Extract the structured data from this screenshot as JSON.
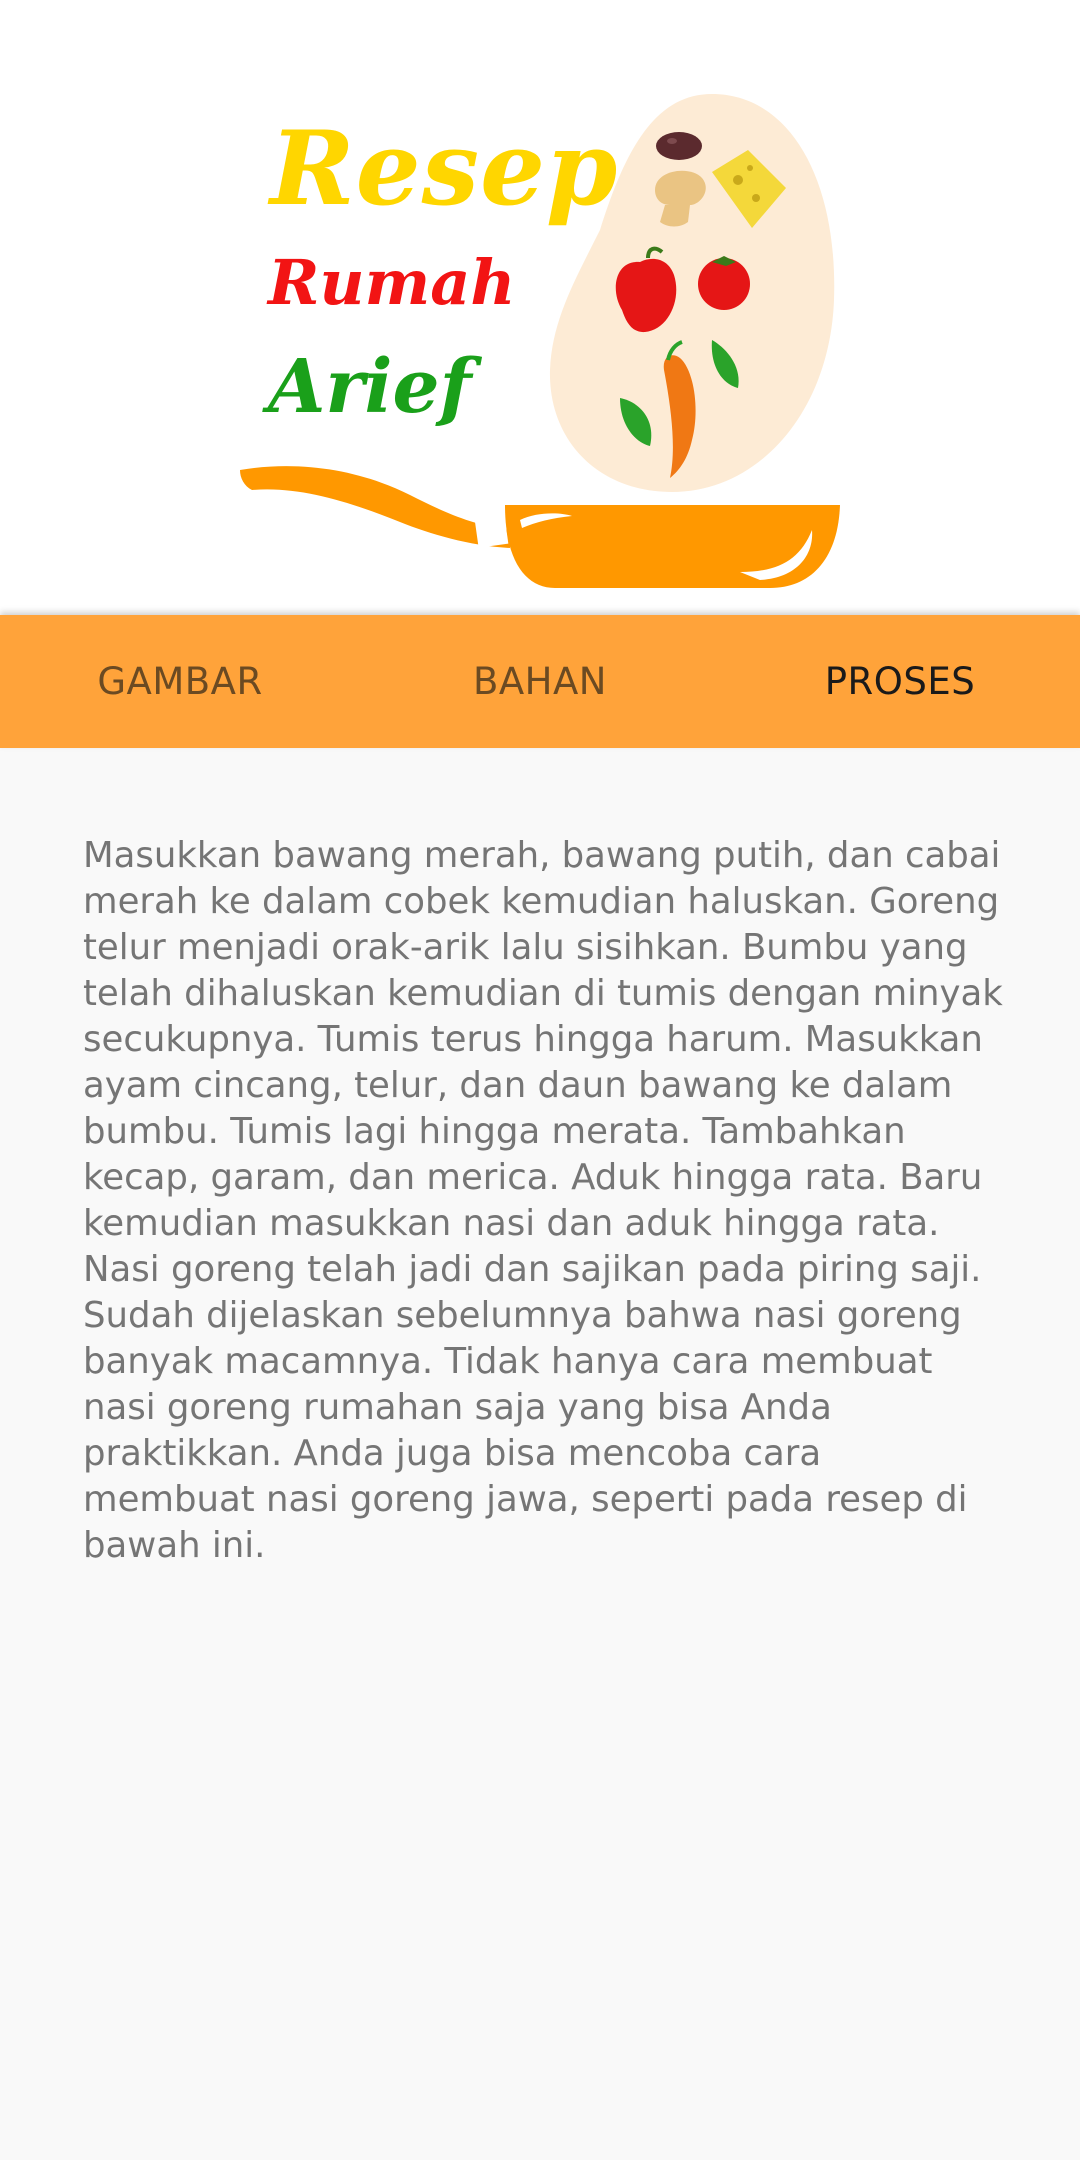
{
  "logo": {
    "line1": "Resep",
    "line2": "Rumah",
    "line3": "Arief"
  },
  "tabs": [
    {
      "label": "GAMBAR",
      "selected": false
    },
    {
      "label": "BAHAN",
      "selected": false
    },
    {
      "label": "PROSES",
      "selected": true
    }
  ],
  "content": {
    "text": "Masukkan bawang merah, bawang putih, dan cabai merah ke dalam cobek kemudian haluskan. Goreng telur menjadi orak-arik lalu sisihkan. Bumbu yang telah dihaluskan kemudian di tumis dengan minyak secukupnya. Tumis terus hingga harum. Masukkan ayam cincang, telur, dan daun bawang ke dalam bumbu. Tumis lagi hingga merata. Tambahkan kecap, garam, dan merica. Aduk hingga rata. Baru kemudian masukkan nasi dan aduk hingga rata. Nasi goreng telah jadi dan sajikan pada piring saji. Sudah dijelaskan sebelumnya bahwa nasi goreng banyak macamnya. Tidak hanya cara membuat nasi goreng rumahan saja yang bisa Anda praktikkan. Anda juga bisa mencoba cara membuat nasi goreng jawa, seperti pada resep di bawah ini."
  },
  "colors": {
    "tab_bar": "#ffa33a",
    "tab_text": "#6b4a22",
    "tab_text_selected": "#1a1a1a",
    "pan": "#ff9800",
    "word1": "#ffd600",
    "word2": "#f21414",
    "word3": "#1aa01a"
  }
}
